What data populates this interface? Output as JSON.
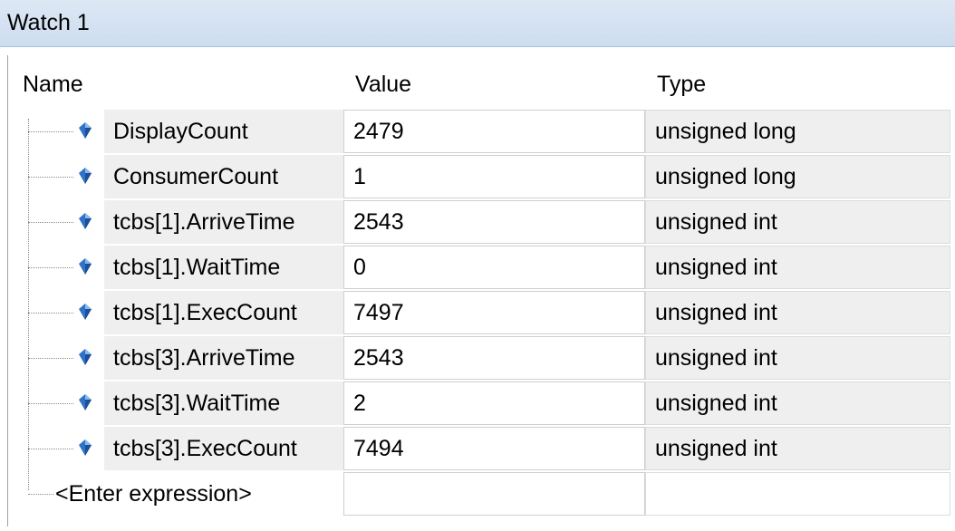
{
  "window": {
    "title": "Watch 1"
  },
  "columns": {
    "name": "Name",
    "value": "Value",
    "type": "Type"
  },
  "rows": [
    {
      "name": "DisplayCount",
      "value": "2479",
      "type": "unsigned long"
    },
    {
      "name": "ConsumerCount",
      "value": "1",
      "type": "unsigned long"
    },
    {
      "name": "tcbs[1].ArriveTime",
      "value": "2543",
      "type": "unsigned int"
    },
    {
      "name": "tcbs[1].WaitTime",
      "value": "0",
      "type": "unsigned int"
    },
    {
      "name": "tcbs[1].ExecCount",
      "value": "7497",
      "type": "unsigned int"
    },
    {
      "name": "tcbs[3].ArriveTime",
      "value": "2543",
      "type": "unsigned int"
    },
    {
      "name": "tcbs[3].WaitTime",
      "value": "2",
      "type": "unsigned int"
    },
    {
      "name": "tcbs[3].ExecCount",
      "value": "7494",
      "type": "unsigned int"
    }
  ],
  "enter_expression": {
    "label": "<Enter expression>",
    "value": "",
    "type": ""
  },
  "icons": {
    "variable": "blue-diamond-icon"
  },
  "colors": {
    "titlebar": "#d4e2f2",
    "icon": "#2f73c9",
    "type_cell": "#efefef"
  }
}
